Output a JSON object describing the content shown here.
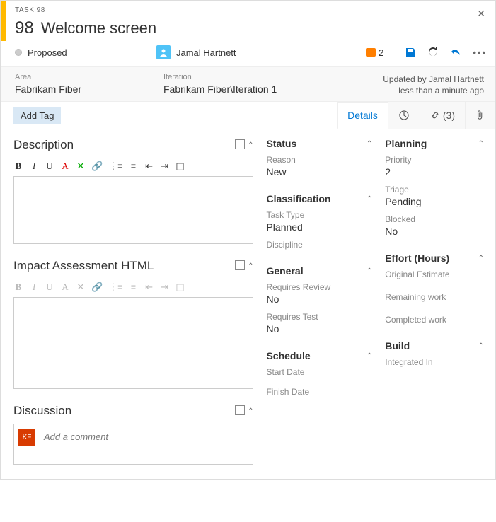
{
  "header": {
    "task_label": "TASK 98",
    "task_number": "98",
    "task_title": "Welcome screen"
  },
  "meta": {
    "state": "Proposed",
    "assignee": "Jamal Hartnett",
    "comment_count": "2",
    "updated_by": "Updated by Jamal Hartnett",
    "updated_time": "less than a minute ago"
  },
  "info": {
    "area_label": "Area",
    "area_value": "Fabrikam Fiber",
    "iteration_label": "Iteration",
    "iteration_value": "Fabrikam Fiber\\Iteration 1"
  },
  "tags": {
    "add_tag": "Add Tag"
  },
  "tabs": {
    "details": "Details",
    "links_count": "(3)"
  },
  "sections": {
    "description": "Description",
    "impact": "Impact Assessment HTML",
    "discussion": "Discussion",
    "status": "Status",
    "classification": "Classification",
    "general": "General",
    "schedule": "Schedule",
    "planning": "Planning",
    "effort": "Effort (Hours)",
    "build": "Build"
  },
  "fields": {
    "reason_label": "Reason",
    "reason_value": "New",
    "tasktype_label": "Task Type",
    "tasktype_value": "Planned",
    "discipline_label": "Discipline",
    "req_review_label": "Requires Review",
    "req_review_value": "No",
    "req_test_label": "Requires Test",
    "req_test_value": "No",
    "start_date_label": "Start Date",
    "finish_date_label": "Finish Date",
    "priority_label": "Priority",
    "priority_value": "2",
    "triage_label": "Triage",
    "triage_value": "Pending",
    "blocked_label": "Blocked",
    "blocked_value": "No",
    "orig_est_label": "Original Estimate",
    "remaining_label": "Remaining work",
    "completed_label": "Completed work",
    "integrated_label": "Integrated In"
  },
  "discussion": {
    "placeholder": "Add a comment",
    "avatar_initials": "KF"
  }
}
